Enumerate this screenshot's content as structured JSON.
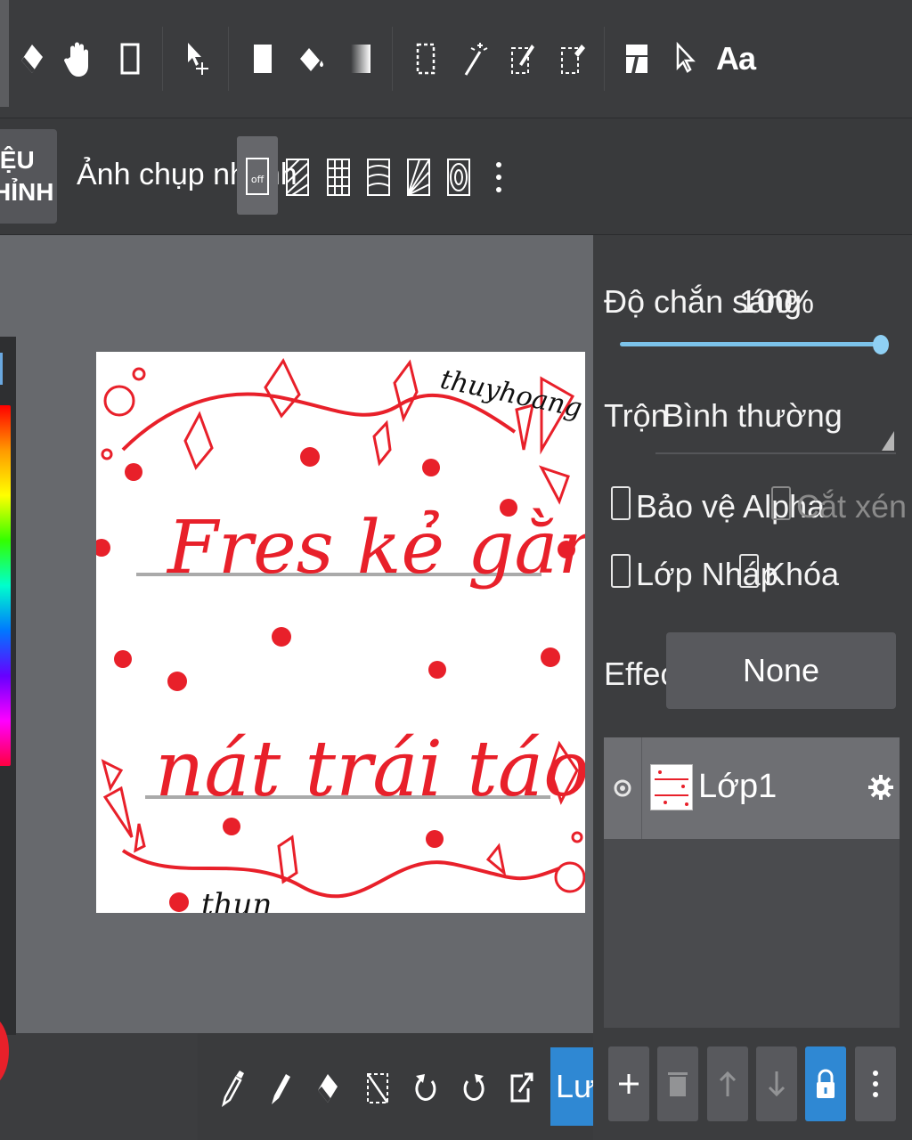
{
  "toolbar": {
    "font_tool_label": "Aa"
  },
  "subbar": {
    "adjust_label": "IỆU\nHỈNH",
    "snapshot_label": "Ảnh chụp nhanh",
    "snap_off_label": "off"
  },
  "artwork": {
    "line1": "Fres kẻ gằm",
    "line2": "nát trái táo",
    "signature_top": "thuyhoang",
    "signature_bottom": "thun"
  },
  "layer_panel": {
    "opacity_label": "Độ chắn sáng",
    "opacity_value": "100",
    "opacity_unit": "%",
    "opacity_fraction": 1.0,
    "blend_label": "Trộn",
    "blend_value": "Bình thường",
    "protect_alpha_label": "Bảo vệ Alpha",
    "clipping_label": "Cắt xén",
    "draft_layer_label": "Lớp Nháp",
    "lock_label": "Khóa",
    "effect_label": "Effect",
    "effect_value": "None",
    "layers": [
      {
        "name": "Lớp1",
        "visible": true
      }
    ]
  },
  "bottom_toolbar": {
    "save_label": "Lưu"
  },
  "colors": {
    "accent": "#2f88d3",
    "current_color": "#e8202a",
    "slider": "#7cc3ea"
  }
}
